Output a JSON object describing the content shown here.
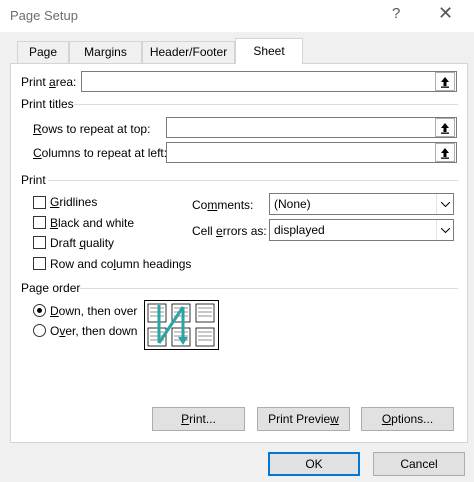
{
  "window": {
    "title": "Page Setup",
    "help": "?",
    "close": "✕"
  },
  "tabs": [
    {
      "label": "Page"
    },
    {
      "label": "Margins"
    },
    {
      "label": "Header/Footer"
    },
    {
      "label": "Sheet"
    }
  ],
  "print_area": {
    "label_pre": "Print ",
    "label_u": "a",
    "label_post": "rea:",
    "value": ""
  },
  "print_titles": {
    "header": "Print titles",
    "rows": {
      "label_u": "R",
      "label_post": "ows to repeat at top:",
      "value": ""
    },
    "columns": {
      "label_u": "C",
      "label_post": "olumns to repeat at left:",
      "value": ""
    }
  },
  "print": {
    "header": "Print",
    "gridlines": {
      "label_u": "G",
      "label_post": "ridlines",
      "checked": false
    },
    "black_white": {
      "label_u": "B",
      "label_post": "lack and white",
      "checked": false
    },
    "draft": {
      "label_pre": "Draft ",
      "label_u": "q",
      "label_post": "uality",
      "checked": false
    },
    "headings": {
      "label_pre": "Row and co",
      "label_u": "l",
      "label_post": "umn headings",
      "checked": false
    },
    "comments": {
      "label_pre": "Co",
      "label_u": "m",
      "label_post": "ments:",
      "value": "(None)"
    },
    "cell_errors": {
      "label_pre": "Cell ",
      "label_u": "e",
      "label_post": "rrors as:",
      "value": "displayed"
    }
  },
  "page_order": {
    "header": "Page order",
    "down_over": {
      "label_u": "D",
      "label_post": "own, then over",
      "selected": true
    },
    "over_down": {
      "label_pre": "O",
      "label_u": "v",
      "label_post": "er, then down",
      "selected": false
    }
  },
  "buttons": {
    "print": {
      "label_pre": "",
      "label_u": "P",
      "label_post": "rint..."
    },
    "preview": {
      "label_pre": "Print Previe",
      "label_u": "w",
      "label_post": ""
    },
    "options": {
      "label_u": "O",
      "label_post": "ptions..."
    },
    "ok": "OK",
    "cancel": "Cancel"
  },
  "colors": {
    "accent": "#0078d7",
    "arrow": "#2aa4a4"
  }
}
